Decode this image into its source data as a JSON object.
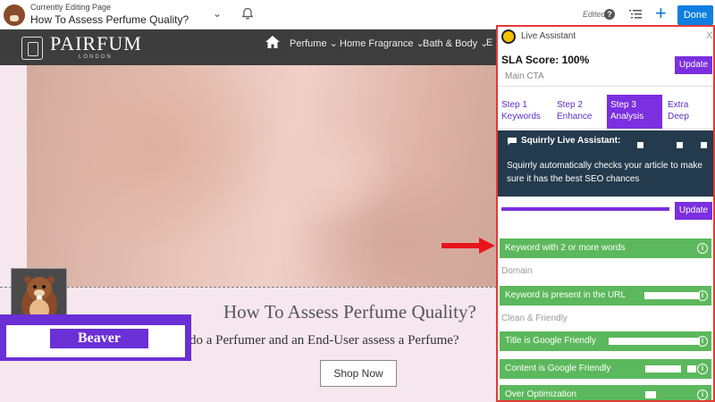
{
  "editor": {
    "editing_label": "Currently Editing Page",
    "page_title": "How To Assess Perfume Quality?",
    "edited_label": "Edited",
    "done_label": "Done"
  },
  "site": {
    "brand": "PAIRFUM",
    "brand_sub": "LONDON",
    "nav": [
      {
        "label": "Perfume"
      },
      {
        "label": "Home Fragrance"
      },
      {
        "label": "Bath & Body"
      },
      {
        "label": "E"
      }
    ]
  },
  "hero": {
    "heading": "How To Assess Perfume Quality?",
    "subheading": "do a Perfumer and an End-User assess a Perfume?",
    "cta": "Shop Now"
  },
  "beaver_tag": "Beaver",
  "assistant": {
    "title": "Live Assistant",
    "close": "X",
    "sla_score": "SLA Score: 100%",
    "main_cta": "Main CTA",
    "update_label": "Update",
    "steps": [
      {
        "line1": "Step 1",
        "line2": "Keywords"
      },
      {
        "line1": "Step 2",
        "line2": "Enhance"
      },
      {
        "line1": "Step 3",
        "line2": "Analysis"
      },
      {
        "line1": "Extra",
        "line2": "Deep"
      }
    ],
    "info_title": "Squirrly Live Assistant:",
    "info_body": "Squirrly automatically checks your article to make sure it has the best SEO chances",
    "checks": [
      {
        "label": "Keyword with 2 or more words"
      },
      {
        "label": "Keyword is present in the URL"
      },
      {
        "label": "Title is Google Friendly"
      },
      {
        "label": "Content is Google Friendly"
      },
      {
        "label": "Over Optimization"
      }
    ],
    "categories": [
      "Domain",
      "Clean & Friendly"
    ]
  },
  "colors": {
    "accent_purple": "#7b2fe0",
    "check_green": "#5cb85c",
    "panel_border": "#e53935",
    "done_blue": "#0e7fe1"
  }
}
